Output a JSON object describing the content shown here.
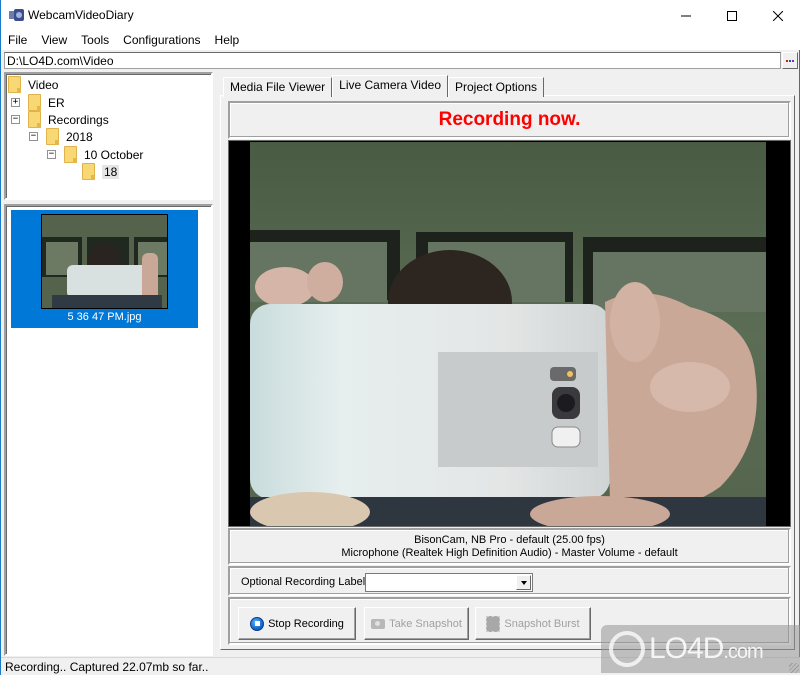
{
  "window": {
    "title": "WebcamVideoDiary",
    "controls": {
      "minimize": "—",
      "maximize": "☐",
      "close": "✕"
    }
  },
  "menu": [
    "File",
    "View",
    "Tools",
    "Configurations",
    "Help"
  ],
  "path": {
    "value": "D:\\LO4D.com\\Video",
    "browse_label": "..."
  },
  "tree": {
    "nodes": [
      {
        "label": "Video",
        "level": 0,
        "expander": "",
        "selected": false
      },
      {
        "label": "ER",
        "level": 1,
        "expander": "+",
        "selected": false
      },
      {
        "label": "Recordings",
        "level": 1,
        "expander": "−",
        "selected": false
      },
      {
        "label": "2018",
        "level": 2,
        "expander": "−",
        "selected": false
      },
      {
        "label": "10 October",
        "level": 3,
        "expander": "−",
        "selected": false
      },
      {
        "label": "18",
        "level": 4,
        "expander": "",
        "selected": true
      }
    ]
  },
  "thumbnails": [
    {
      "caption": "5 36 47 PM.jpg",
      "selected": true
    }
  ],
  "tabs": [
    {
      "label": "Media File Viewer",
      "active": false
    },
    {
      "label": "Live Camera Video",
      "active": true
    },
    {
      "label": "Project Options",
      "active": false
    }
  ],
  "live": {
    "status": "Recording now.",
    "status_color": "#ff0000",
    "device_line1": "BisonCam, NB Pro - default (25.00 fps)",
    "device_line2": "Microphone (Realtek High Definition Audio) - Master Volume - default",
    "label_prompt": "Optional Recording Label:",
    "label_value": "",
    "buttons": {
      "stop": "Stop Recording",
      "snapshot": "Take Snapshot",
      "burst": "Snapshot Burst"
    }
  },
  "statusbar": {
    "text": "Recording.. Captured 22.07mb so far.."
  },
  "watermark": {
    "text": "LO4D",
    "suffix": ".com"
  },
  "colors": {
    "selection": "#0078d7",
    "accent_border": "#1979ca"
  }
}
